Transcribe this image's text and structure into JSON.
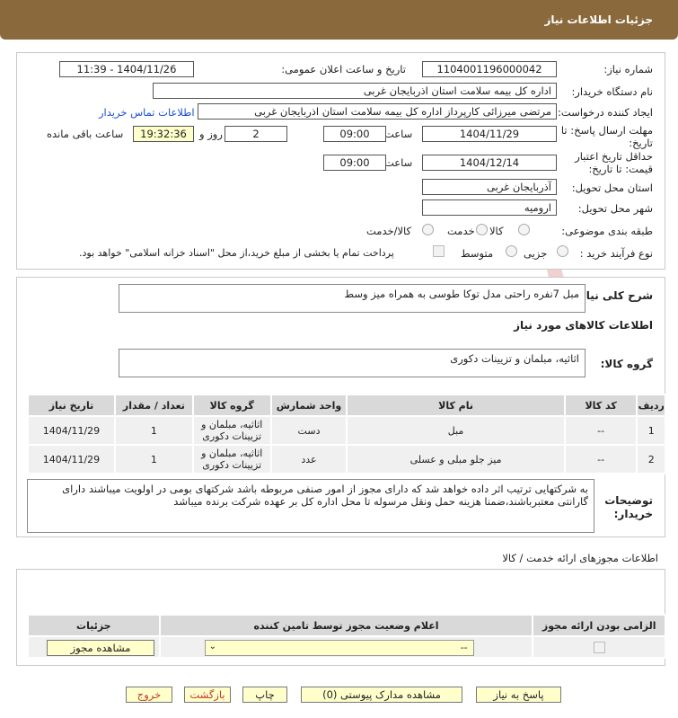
{
  "header": {
    "title": "جزئیات اطلاعات نیاز"
  },
  "form": {
    "need_number_label": "شماره نیاز:",
    "need_number": "1104001196000042",
    "announce_label": "تاریخ و ساعت اعلان عمومی:",
    "announce_value": "1404/11/26 - 11:39",
    "buyer_label": "نام دستگاه خریدار:",
    "buyer_value": "اداره کل بیمه سلامت استان اذربایجان غربی",
    "creator_label": "ایجاد کننده درخواست:",
    "creator_value": "مرتضی میرزائی کارپرداز اداره کل بیمه سلامت استان اذربایجان غربی",
    "contact_link": "اطلاعات تماس خریدار",
    "deadline_label_1": "مهلت ارسال پاسخ: تا",
    "deadline_label_2": "تاریخ:",
    "deadline_date": "1404/11/29",
    "time_label": "ساعت",
    "deadline_time": "09:00",
    "days_value": "2",
    "days_label": "روز و",
    "remaining_time": "19:32:36",
    "remaining_label": "ساعت باقی مانده",
    "validity_label_1": "حداقل تاریخ اعتبار",
    "validity_label_2": "قیمت: تا تاریخ:",
    "validity_date": "1404/12/14",
    "validity_time": "09:00",
    "province_label": "استان محل تحویل:",
    "province_value": "آذربایجان غربی",
    "city_label": "شهر محل تحویل:",
    "city_value": "ارومیه",
    "category_label": "طبقه بندی موضوعی:",
    "category_options": [
      "کالا",
      "خدمت",
      "کالا/خدمت"
    ],
    "process_label": "نوع فرآیند خرید :",
    "process_options": [
      "جزیی",
      "متوسط"
    ],
    "payment_note": "پرداخت تمام یا بخشی از مبلغ خرید،از محل \"اسناد خزانه اسلامی\" خواهد بود."
  },
  "description": {
    "label": "شرح کلی نیاز:",
    "value": "مبل 7نفره راحتی مدل توکا طوسی به همراه میز وسط",
    "goods_info_title": "اطلاعات کالاهای مورد نیاز",
    "group_label": "گروه کالا:",
    "group_value": "اثاثیه، مبلمان و تزیینات دکوری"
  },
  "items_table": {
    "headers": [
      "ردیف",
      "کد کالا",
      "نام کالا",
      "واحد شمارش",
      "گروه کالا",
      "تعداد / مقدار",
      "تاریخ نیاز"
    ],
    "rows": [
      [
        "1",
        "--",
        "مبل",
        "دست",
        "اثاثیه، مبلمان و تزیینات دکوری",
        "1",
        "1404/11/29"
      ],
      [
        "2",
        "--",
        "میز جلو مبلی و عسلی",
        "عدد",
        "اثاثیه، مبلمان و تزیینات دکوری",
        "1",
        "1404/11/29"
      ]
    ]
  },
  "buyer_notes": {
    "label_1": "توضیحات",
    "label_2": "خریدار:",
    "value": "به شرکتهایی ترتیب اثر داده خواهد شد که دارای مجوز از امور صنفی مربوطه باشد شرکتهای بومی در اولویت میباشند دارای گارانتی معتبرباشند،ضمنا هزینه حمل ونقل مرسوله تا محل اداره کل بر عهده شرکت برنده میباشد"
  },
  "permits": {
    "title": "اطلاعات مجوزهای ارائه خدمت / کالا",
    "headers": [
      "الزامی بودن ارائه مجوز",
      "اعلام وضعیت مجوز توسط تامین کننده",
      "جزئیات"
    ],
    "select_value": "--",
    "view_button": "مشاهده مجوز"
  },
  "buttons": {
    "reply": "پاسخ به نیاز",
    "docs": "مشاهده مدارک پیوستی (0)",
    "print": "چاپ",
    "back": "بازگشت",
    "exit": "خروج"
  },
  "watermark_text": "AriaTender.neT",
  "colors": {
    "header": "#8a6a3c",
    "field_yellow": "#ffffcc",
    "link": "#1a4fd6"
  }
}
